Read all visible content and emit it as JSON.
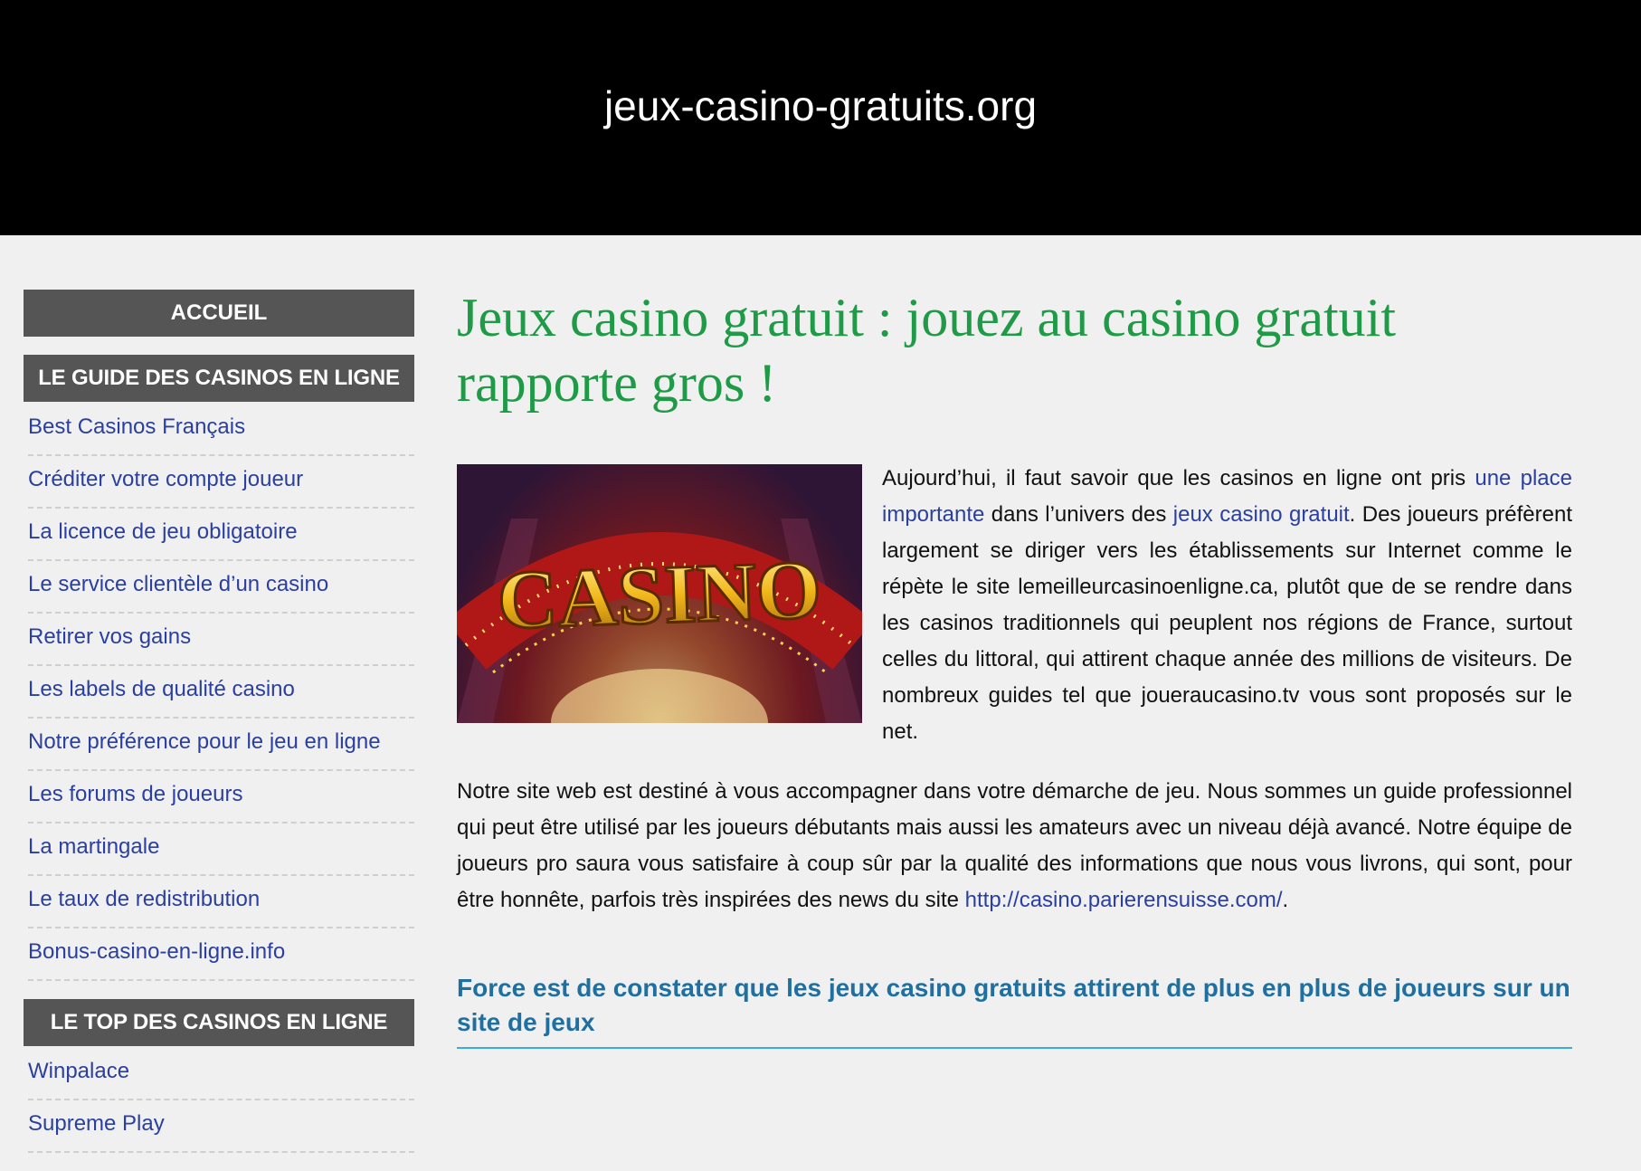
{
  "header": {
    "site_title": "jeux-casino-gratuits.org"
  },
  "sidebar": {
    "home_label": "ACCUEIL",
    "guide_heading": "LE GUIDE DES CASINOS EN LIGNE",
    "guide_items": [
      "Best Casinos Français",
      "Créditer votre compte joueur",
      "La licence de jeu obligatoire",
      "Le service clientèle d’un casino",
      "Retirer vos gains",
      "Les labels de qualité casino",
      "Notre préférence pour le jeu en ligne",
      "Les forums de joueurs",
      "La martingale",
      "Le taux de redistribution",
      "Bonus-casino-en-ligne.info"
    ],
    "top_heading": "LE TOP DES CASINOS EN LIGNE",
    "top_items": [
      "Winpalace",
      "Supreme Play"
    ]
  },
  "main": {
    "title": "Jeux casino gratuit : jouez au casino gratuit rapporte gros !",
    "image_text": "CASINO",
    "p1": {
      "t1": "Aujourd’hui, il faut savoir que les casinos en ligne ont pris ",
      "link1": "une place importante",
      "t2": " dans l’univers des ",
      "link2": "jeux casino gratuit",
      "t3": ". Des joueurs préfèrent largement se diriger vers les établissements sur Internet comme le répète le site lemeilleurcasinoenligne.ca, plutôt que de se rendre dans les casinos traditionnels qui peuplent nos régions de France, surtout celles du littoral, qui attirent chaque année des millions de visiteurs. De nombreux guides tel que joueraucasino.tv vous sont proposés sur le net."
    },
    "p2": {
      "t1": "Notre site web est destiné à vous accompagner dans votre démarche de jeu. Nous sommes un guide professionnel qui peut être utilisé par les joueurs débutants mais aussi les amateurs avec un niveau déjà avancé. Notre équipe de joueurs pro saura vous satisfaire à coup sûr par la qualité des informations que nous vous livrons, qui sont, pour être honnête, parfois très inspirées des news du site ",
      "link": "http://casino.parierensuisse.com/",
      "t2": "."
    },
    "subheading": "Force est de constater que les jeux casino gratuits attirent de plus en plus de joueurs sur un site de jeux"
  },
  "colors": {
    "title_green": "#1f9a46",
    "link_blue": "#2a3fa0",
    "sub_blue": "#1f6fa0",
    "side_head_bg": "#555555"
  }
}
